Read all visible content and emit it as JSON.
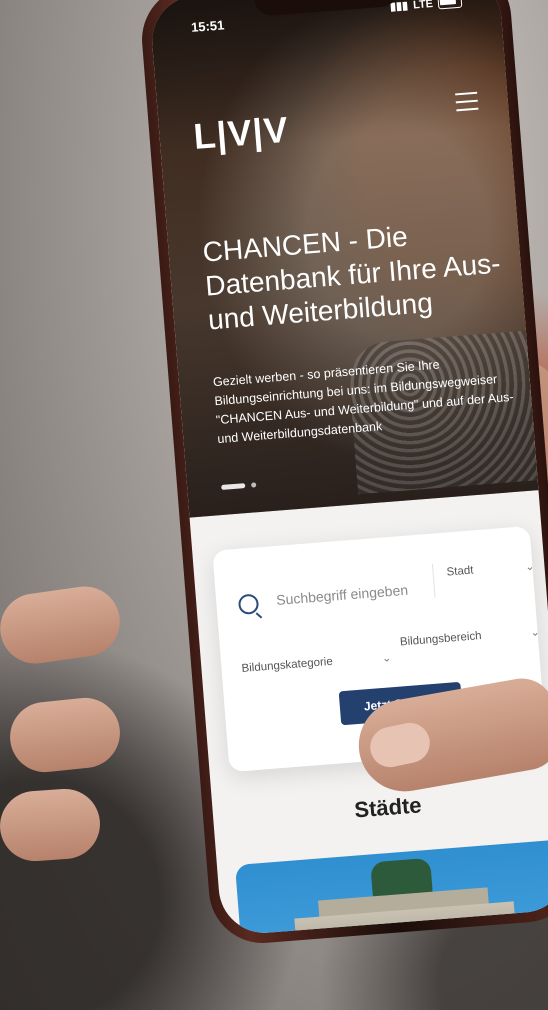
{
  "status_bar": {
    "time": "15:51",
    "network": "LTE"
  },
  "header": {
    "logo": "L|V|V",
    "menu_icon": "hamburger-menu-icon"
  },
  "hero": {
    "title": "CHANCEN - Die Datenbank für Ihre Aus- und Weiterbildung",
    "subtitle": "Gezielt werben - so präsentieren Sie Ihre Bildungseinrichtung bei uns: im Bildungswegweiser \"CHANCEN Aus- und Weiterbildung\" und auf der Aus- und Weiterbildungsdatenbank"
  },
  "search": {
    "placeholder": "Suchbegriff eingeben",
    "city_select": "Stadt",
    "category_select": "Bildungskategorie",
    "area_select": "Bildungsbereich",
    "submit_label": "Jetzt Suchen"
  },
  "cities": {
    "title": "Städte"
  },
  "colors": {
    "button": "#23406e",
    "search_icon": "#2c4a7a",
    "city_card_sky": "#2f8fd0"
  }
}
